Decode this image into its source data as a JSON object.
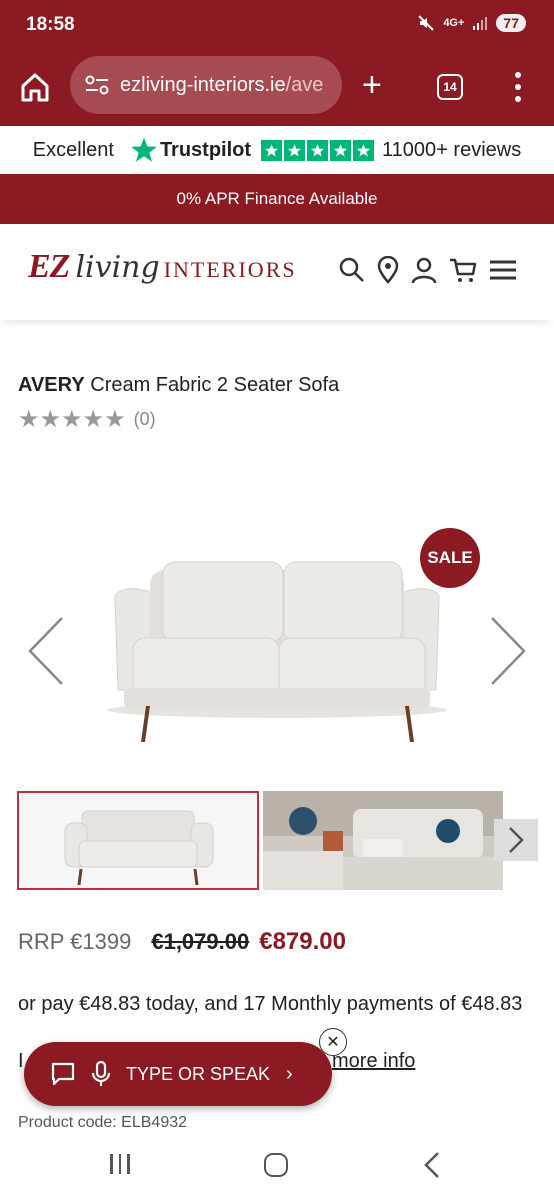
{
  "status_bar": {
    "time": "18:58",
    "network": "4G+",
    "battery": "77"
  },
  "browser": {
    "url_main": "ezliving-interiors.ie",
    "url_rest": "/ave",
    "tab_count": "14"
  },
  "trustpilot": {
    "label": "Excellent",
    "brand": "Trustpilot",
    "reviews": "11000+ reviews"
  },
  "promo": {
    "text": "0% APR Finance Available"
  },
  "logo": {
    "ez": "EZ",
    "living": "living",
    "interiors": "INTERIORS"
  },
  "product": {
    "brand": "AVERY",
    "name": " Cream Fabric 2 Seater Sofa",
    "rating_count": "(0)",
    "stars": "★★★★★",
    "sale_badge": "SALE",
    "rrp": "RRP €1399",
    "was_price": "€1,079.00",
    "now_price": "€879.00",
    "payments": "or pay €48.83 today, and 17 Monthly payments of €48.83",
    "info_prefix": "I",
    "more_info": "more info",
    "code": "Product code: ELB4932"
  },
  "assistant": {
    "label": "TYPE OR SPEAK",
    "chevron": "›",
    "close": "✕"
  },
  "colors": {
    "brand": "#8b1a22",
    "trustpilot_green": "#00b67a"
  }
}
